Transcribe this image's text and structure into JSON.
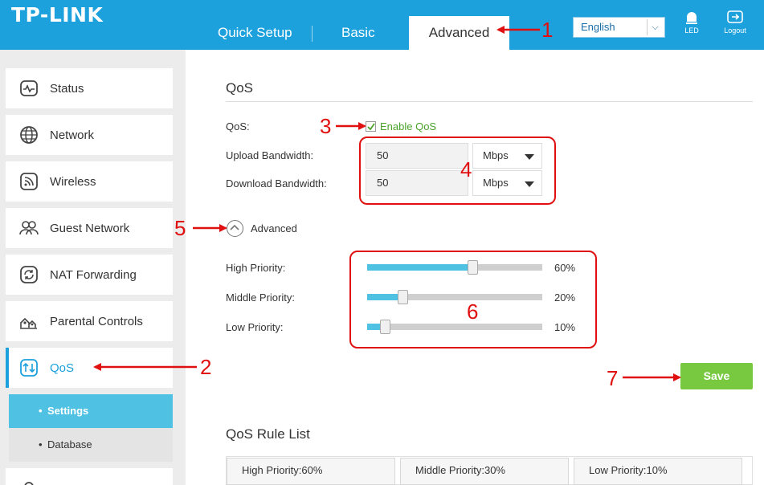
{
  "header": {
    "logo": "TP-LINK",
    "tabs": [
      "Quick Setup",
      "Basic",
      "Advanced"
    ],
    "active_tab": "Advanced",
    "language": "English",
    "led_label": "LED",
    "logout_label": "Logout"
  },
  "sidebar": {
    "items": [
      {
        "label": "Status",
        "icon": "status-icon"
      },
      {
        "label": "Network",
        "icon": "globe-icon"
      },
      {
        "label": "Wireless",
        "icon": "wireless-icon"
      },
      {
        "label": "Guest Network",
        "icon": "guest-network-icon"
      },
      {
        "label": "NAT Forwarding",
        "icon": "nat-forwarding-icon"
      },
      {
        "label": "Parental Controls",
        "icon": "parental-controls-icon"
      },
      {
        "label": "QoS",
        "icon": "qos-icon"
      }
    ],
    "subitems": [
      "Settings",
      "Database"
    ],
    "active_item": "QoS",
    "active_subitem": "Settings"
  },
  "qos": {
    "section_title": "QoS",
    "qos_label": "QoS:",
    "enable_label": "Enable QoS",
    "enabled": true,
    "upload_label": "Upload Bandwidth:",
    "upload_value": "50",
    "upload_unit": "Mbps",
    "download_label": "Download Bandwidth:",
    "download_value": "50",
    "download_unit": "Mbps",
    "advanced_label": "Advanced",
    "priorities": [
      {
        "label": "High Priority:",
        "value": 60,
        "display": "60%"
      },
      {
        "label": "Middle Priority:",
        "value": 20,
        "display": "20%"
      },
      {
        "label": "Low Priority:",
        "value": 10,
        "display": "10%"
      }
    ],
    "save_label": "Save"
  },
  "rule_list": {
    "title": "QoS Rule List",
    "columns": [
      "High Priority:60%",
      "Middle Priority:30%",
      "Low Priority:10%"
    ]
  },
  "annotations": [
    "1",
    "2",
    "3",
    "4",
    "5",
    "6",
    "7"
  ],
  "colors": {
    "header_blue": "#1ca1dc",
    "active_sub": "#4fc2e3",
    "save_green": "#78c840",
    "annotation_red": "#e01010",
    "enable_green": "#4aa32a"
  }
}
